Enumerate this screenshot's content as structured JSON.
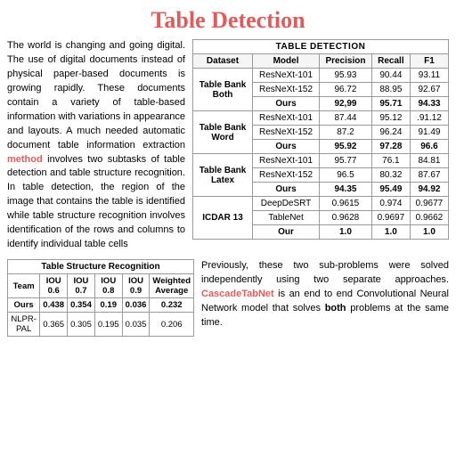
{
  "title": "Table Detection",
  "left_text_parts": [
    "The world is changing and going digital. The use of digital documents ",
    "instead",
    " of physical paper-based documents is growing rapidly. These documents contain a variety of table-based ",
    "information",
    " with variations in appearance and layouts. A much needed automatic document table information extraction ",
    "method",
    " involves two subtasks of table detection and table structure recognition. In table detection, the region of the image that contains the table is identified while table structure recognition involves identification of the rows and columns to identify individual table cells"
  ],
  "detection_table": {
    "title": "TABLE DETECTION",
    "headers": [
      "Dataset",
      "Model",
      "Precision",
      "Recall",
      "F1"
    ],
    "groups": [
      {
        "label": "Table Bank Both",
        "rows": [
          [
            "",
            "ResNeXt-101",
            "95.93",
            "90.44",
            "93.11"
          ],
          [
            "",
            "ResNeXt-152",
            "96.72",
            "88.95",
            "92.67"
          ],
          [
            "",
            "Ours",
            "92.99",
            "95.71",
            "94.33"
          ]
        ],
        "bold_row": 2
      },
      {
        "label": "Table Bank Word",
        "rows": [
          [
            "",
            "ResNeXt-101",
            "87.44",
            "95.12",
            "91.12"
          ],
          [
            "",
            "ResNeXt-152",
            "87.2",
            "96.24",
            "91.49"
          ],
          [
            "",
            "Ours",
            "95.92",
            "97.28",
            "96.6"
          ]
        ],
        "bold_row": 2
      },
      {
        "label": "Table Bank Latex",
        "rows": [
          [
            "",
            "ResNeXt-101",
            "95.77",
            "76.1",
            "84.81"
          ],
          [
            "",
            "ResNeXt-152",
            "96.5",
            "80.32",
            "87.67"
          ],
          [
            "",
            "Ours",
            "94.35",
            "95.49",
            "94.92"
          ]
        ],
        "bold_row": 2
      },
      {
        "label": "ICDAR 13",
        "rows": [
          [
            "",
            "DeepDeSRT",
            "0.9615",
            "0.974",
            "0.9677"
          ],
          [
            "",
            "TableNet",
            "0.9628",
            "0.9697",
            "0.9662"
          ],
          [
            "",
            "Our",
            "1.0",
            "1.0",
            "1.0"
          ]
        ],
        "bold_row": 2
      }
    ]
  },
  "structure_table": {
    "title": "Table Structure Recognition",
    "headers": [
      "Team",
      "IOU 0.6",
      "IOU 0.7",
      "IOU 0.8",
      "IOU 0.9",
      "Weighted Average"
    ],
    "rows": [
      [
        "Ours",
        "0.438",
        "0.354",
        "0.19",
        "0.036",
        "0.232"
      ],
      [
        "NLPR-PAL",
        "0.365",
        "0.305",
        "0.195",
        "0.035",
        "0.206"
      ]
    ],
    "bold_rows": [
      0
    ]
  },
  "bottom_text": "Previously, these two sub-problems were solved independently using two separate approaches. CascadeTabNet is an end to end Convolutional Neural Network model that solves both problems at the same time."
}
